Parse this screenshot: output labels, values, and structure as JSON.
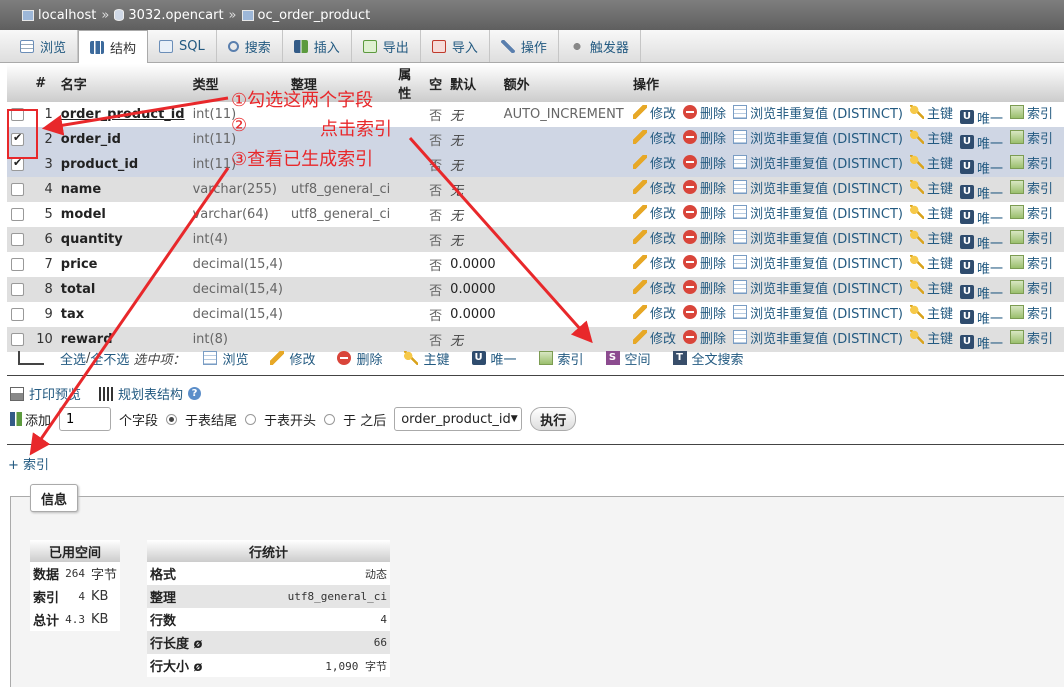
{
  "breadcrumb": [
    {
      "label": "localhost",
      "icon": "server-icon"
    },
    {
      "label": "3032.opencart",
      "icon": "database-icon"
    },
    {
      "label": "oc_order_product",
      "icon": "table-icon"
    }
  ],
  "breadcrumb_sep": "»",
  "tabs": [
    {
      "label": "浏览",
      "icon": "browse-icon",
      "active": false
    },
    {
      "label": "结构",
      "icon": "structure-icon",
      "active": true
    },
    {
      "label": "SQL",
      "icon": "sql-icon",
      "active": false
    },
    {
      "label": "搜索",
      "icon": "search-icon",
      "active": false
    },
    {
      "label": "插入",
      "icon": "insert-icon",
      "active": false
    },
    {
      "label": "导出",
      "icon": "export-icon",
      "active": false
    },
    {
      "label": "导入",
      "icon": "import-icon",
      "active": false
    },
    {
      "label": "操作",
      "icon": "wrench-icon",
      "active": false
    },
    {
      "label": "触发器",
      "icon": "trigger-icon",
      "active": false
    }
  ],
  "table": {
    "headers": {
      "num": "#",
      "name": "名字",
      "type": "类型",
      "collation": "整理",
      "attributes": "属性",
      "null": "空",
      "default": "默认",
      "extra": "额外",
      "action": "操作"
    },
    "actions": {
      "change": "修改",
      "drop": "删除",
      "distinct": "浏览非重复值 (DISTINCT)",
      "primary": "主键",
      "unique": "唯一",
      "index": "索引"
    },
    "rows": [
      {
        "num": "1",
        "name": "order_product_id",
        "type": "int(11)",
        "collation": "",
        "attributes": "",
        "null": "否",
        "default": "无",
        "extra": "AUTO_INCREMENT",
        "checked": false
      },
      {
        "num": "2",
        "name": "order_id",
        "type": "int(11)",
        "collation": "",
        "attributes": "",
        "null": "否",
        "default": "无",
        "extra": "",
        "checked": true
      },
      {
        "num": "3",
        "name": "product_id",
        "type": "int(11)",
        "collation": "",
        "attributes": "",
        "null": "否",
        "default": "无",
        "extra": "",
        "checked": true
      },
      {
        "num": "4",
        "name": "name",
        "type": "varchar(255)",
        "collation": "utf8_general_ci",
        "attributes": "",
        "null": "否",
        "default": "无",
        "extra": "",
        "checked": false
      },
      {
        "num": "5",
        "name": "model",
        "type": "varchar(64)",
        "collation": "utf8_general_ci",
        "attributes": "",
        "null": "否",
        "default": "无",
        "extra": "",
        "checked": false
      },
      {
        "num": "6",
        "name": "quantity",
        "type": "int(4)",
        "collation": "",
        "attributes": "",
        "null": "否",
        "default": "无",
        "extra": "",
        "checked": false
      },
      {
        "num": "7",
        "name": "price",
        "type": "decimal(15,4)",
        "collation": "",
        "attributes": "",
        "null": "否",
        "default": "0.0000",
        "extra": "",
        "checked": false
      },
      {
        "num": "8",
        "name": "total",
        "type": "decimal(15,4)",
        "collation": "",
        "attributes": "",
        "null": "否",
        "default": "0.0000",
        "extra": "",
        "checked": false
      },
      {
        "num": "9",
        "name": "tax",
        "type": "decimal(15,4)",
        "collation": "",
        "attributes": "",
        "null": "否",
        "default": "0.0000",
        "extra": "",
        "checked": false
      },
      {
        "num": "10",
        "name": "reward",
        "type": "int(8)",
        "collation": "",
        "attributes": "",
        "null": "否",
        "default": "无",
        "extra": "",
        "checked": false
      }
    ]
  },
  "bulk": {
    "select_all": "全选",
    "separator": " / ",
    "unselect_all": "全不选",
    "with_selected": "选中项：",
    "actions": [
      "浏览",
      "修改",
      "删除",
      "主键",
      "唯一",
      "索引",
      "空间",
      "全文搜索"
    ]
  },
  "print_view": "打印预览",
  "propose_structure": "规划表结构",
  "add_row": {
    "add_label": "添加",
    "count": "1",
    "fields_label": "个字段",
    "end_label": "于表结尾",
    "begin_label": "于表开头",
    "after_label": "于 之后",
    "after_field": "order_product_id",
    "go": "执行"
  },
  "index_link": "+ 索引",
  "info": {
    "legend": "信息",
    "space_header": "已用空间",
    "space_rows": [
      {
        "label": "数据",
        "value": "264",
        "unit": "字节"
      },
      {
        "label": "索引",
        "value": "4",
        "unit": "KB"
      },
      {
        "label": "总计",
        "value": "4.3",
        "unit": "KB"
      }
    ],
    "stats_header": "行统计",
    "stats_rows": [
      {
        "label": "格式",
        "value": "动态"
      },
      {
        "label": "整理",
        "value": "utf8_general_ci"
      },
      {
        "label": "行数",
        "value": "4"
      },
      {
        "label": "行长度 ø",
        "value": "66"
      },
      {
        "label": "行大小 ø",
        "value": "1,090 字节"
      }
    ]
  },
  "annotations": {
    "step1": "①勾选这两个字段",
    "step2": "②",
    "step2b": "点击索引",
    "step3": "③查看已生成索引",
    "color": "#e8282b"
  }
}
